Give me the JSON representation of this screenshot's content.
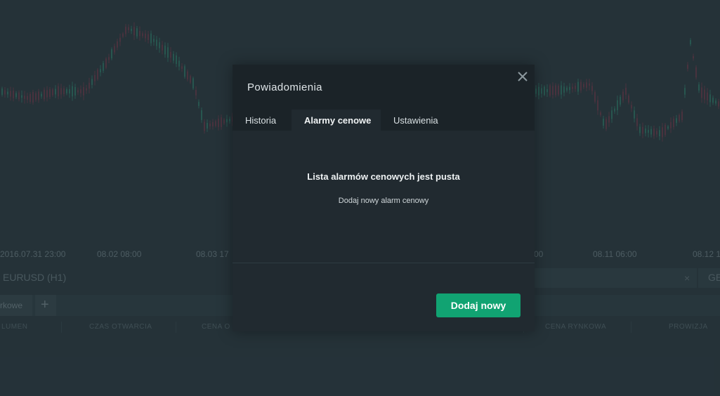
{
  "background": {
    "time_axis": [
      "2016.07.31 23:00",
      "08.02 08:00",
      "08.03 17",
      "00",
      "08.11 06:00",
      "08.12 1"
    ],
    "symbol": {
      "name": "EURUSD (H1)",
      "close": "×",
      "next_symbol_partial": "GE"
    },
    "position_tabs": {
      "active_partial": "rkowe",
      "add": "+"
    },
    "columns": [
      "LUMEN",
      "CZAS OTWARCIA",
      "CENA O",
      "CENA RYNKOWA",
      "PROWIZJA"
    ],
    "colors": {
      "bg": "#2b3b42",
      "candle_up": "#2f6d62",
      "candle_down": "#5e3b4a"
    }
  },
  "modal": {
    "title": "Powiadomienia",
    "close_icon": "close-icon",
    "tabs": [
      {
        "label": "Historia",
        "active": false
      },
      {
        "label": "Alarmy cenowe",
        "active": true
      },
      {
        "label": "Ustawienia",
        "active": false
      }
    ],
    "empty_title": "Lista alarmów cenowych jest pusta",
    "empty_subtitle": "Dodaj nowy alarm cenowy",
    "add_button": "Dodaj nowy",
    "colors": {
      "accent": "#11a372",
      "header": "#1b2328",
      "body": "#212a30"
    }
  }
}
